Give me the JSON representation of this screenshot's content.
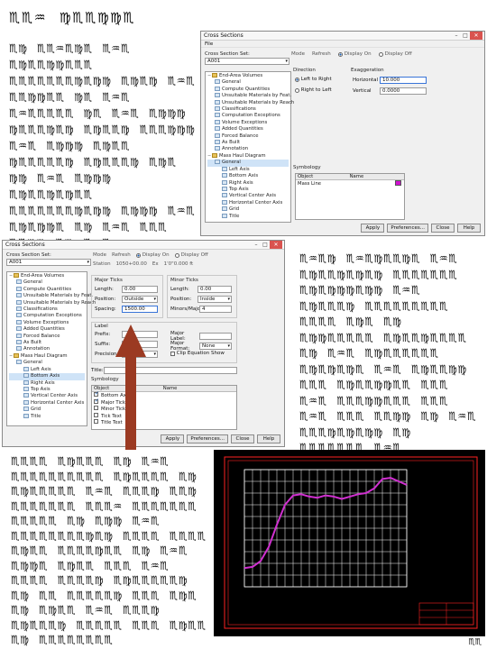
{
  "cipher_text": {
    "title": "♏♏♒ ♍♏♏♍♍♏",
    "p1": "♏♍ ♏♏♒♏♍♏ ♏♒♏ ♏♍♏♏♍♍♏♏♏ ♏♏♏♏♏♏♏♍♏♍♍ ♏♍♏♍ ♏♒♏ ♏♏♍♍♏♏ ♍♏ ♏♒♏ ♏♒♏♏♏♏♏ ♍♏ ♏♒♏ ♏♍♍♍ ♍♏♏♏♍♏♍ ♏♍♏♏♍ ♏♏♏♍♍♍ ♏♒♏ ♏♍♍♍ ♏♍♏♏ ♍♏♏♏♏♏♍ ♏♍♏♏♏♍ ♏♍♏ ♍♍ ♏♒♏ ♏♍♍♍ ♏♍♏♏♍♏♍♏♏ ♏♏♏♏♏♏♏♍♏♍♍ ♏♍♍♍ ♏♒♏ ♏♍♏♍♍♏ ♏♍ ♏♒♏ ♏♏♏ ♏♏♍♍ ♏♍ ♏♒♏ ♏♏♏♍♏♍♏♍♍",
    "p2": "♏♒♏♍ ♏♒♏♍♏♏♍♏ ♏♒♏ ♏♍♏♏♍♏♍♏♍ ♏♏♏♏♏♏♏ ♏♍♏♍♍♍♏♍♍ ♏♒♏ ♏♍♏♏♏♍ ♏♏♏♏♏♏♏♏♏ ♏♏♏♏ ♏♍♏ ♏♍ ♏♍♍♏♏♏♏♏ ♏♍♏♏♍♏♏♏♏ ♏♍ ♏♒♏ ♏♍♏♏♏♏♏♏ ♏♍♏♍♏♍♏ ♏♒♏ ♏♍♏♏♍♍ ♏♏♏ ♏♍♏♏♍♍♏♏ ♏♏♏ ♏♒♏ ♏♏♏♍♍♏♏♏ ♏♏♏ ♏♒♏ ♏♏♏ ♏♏♍♍ ♏♍ ♏♒♏ ♏♏♏♍♏♍♏♍♍ ♏♍ ♏♏♏♏♏♏♏ ♏♒♏",
    "p3": "♏♏♏♏ ♏♍♏♏♏ ♏♍ ♏♒♏ ♏♏♏♏♏♏♏♏♏♏ ♏♍♏♏♏♏ ♏♍ ♏♍♏♏♏♏♏ ♏♒♏ ♏♏♏♍ ♏♏♍ ♏♏♏♏♏♏♏ ♏♏♏♒ ♏♏♏♏♏♏♏ ♏♏♏♏♏ ♏♍ ♏♍♍ ♏♒♏ ♏♏♏♏♏♏♏♏♍♏♍ ♏♏♏♏ ♏♏♏♏ ♏♍♏♏ ♏♏♏♏♍♏♏ ♏♍ ♏♒♏ ♏♍♍♏ ♏♍♏♏ ♏♏♏ ♏♒♏ ♏♏♏♏ ♏♏♏♏♍ ♏♍♏♏♏♏♏♍ ♏♍ ♏♏ ♏♏♏♏♏♍ ♏♏♏ ♏♍♏ ♏♍ ♏♍♏♏ ♏♒♏ ♏♏♏♍ ♏♍♏♏♏♍ ♏♏♏♏♏ ♏♏♏ ♏♍♏♏ ♏♍ ♏♏♏♏♏♏♏♏",
    "page": "♏♏"
  },
  "window_top": {
    "title": "Cross Sections",
    "menu": "File",
    "section_set_label": "Cross Section Set:",
    "section_set_value": "A001",
    "toolbar": {
      "mode": "Mode",
      "refresh": "Refresh",
      "display_on": "Display On",
      "display_off": "Display Off"
    },
    "tree": [
      {
        "label": "End-Area Volumes",
        "level": 0,
        "kind": "folder",
        "expand": "−"
      },
      {
        "label": "General",
        "level": 1,
        "kind": "item"
      },
      {
        "label": "Compute Quantities",
        "level": 1,
        "kind": "item"
      },
      {
        "label": "Unsuitable Materials by Feat.",
        "level": 1,
        "kind": "item"
      },
      {
        "label": "Unsuitable Materials by Reach",
        "level": 1,
        "kind": "item"
      },
      {
        "label": "Classifications",
        "level": 1,
        "kind": "item"
      },
      {
        "label": "Computation Exceptions",
        "level": 1,
        "kind": "item"
      },
      {
        "label": "Volume Exceptions",
        "level": 1,
        "kind": "item"
      },
      {
        "label": "Added Quantities",
        "level": 1,
        "kind": "item"
      },
      {
        "label": "Forced Balance",
        "level": 1,
        "kind": "item"
      },
      {
        "label": "As Built",
        "level": 1,
        "kind": "item"
      },
      {
        "label": "Annotation",
        "level": 1,
        "kind": "item"
      },
      {
        "label": "Mass Haul Diagram",
        "level": 0,
        "kind": "folder",
        "expand": "−"
      },
      {
        "label": "General",
        "level": 1,
        "kind": "item",
        "selected": true
      },
      {
        "label": "Left Axis",
        "level": 2,
        "kind": "item"
      },
      {
        "label": "Bottom Axis",
        "level": 2,
        "kind": "item"
      },
      {
        "label": "Right Axis",
        "level": 2,
        "kind": "item"
      },
      {
        "label": "Top Axis",
        "level": 2,
        "kind": "item"
      },
      {
        "label": "Vertical Center Axis",
        "level": 2,
        "kind": "item"
      },
      {
        "label": "Horizontal Center Axis",
        "level": 2,
        "kind": "item"
      },
      {
        "label": "Grid",
        "level": 2,
        "kind": "item"
      },
      {
        "label": "Title",
        "level": 2,
        "kind": "item"
      }
    ],
    "direction_label": "Direction",
    "dir_left_right": "Left to Right",
    "dir_right_left": "Right to Left",
    "exag_label": "Exaggeration",
    "horizontal_label": "Horizontal",
    "horizontal_value": "10.000",
    "vertical_label": "Vertical",
    "vertical_value": "0.0000",
    "symbology_label": "Symbology",
    "table_headers": [
      "Object",
      "Name"
    ],
    "table_rows": [
      {
        "object": "Mass Line",
        "color": "#d010d0"
      }
    ],
    "buttons": {
      "apply": "Apply",
      "preferences": "Preferences...",
      "close": "Close",
      "help": "Help"
    }
  },
  "window_bot": {
    "title": "Cross Sections",
    "section_set_label": "Cross Section Set:",
    "section_set_value": "A001",
    "toolbar": {
      "mode": "Mode",
      "refresh": "Refresh",
      "display_on": "Display On",
      "display_off": "Display Off",
      "station": "Station",
      "station_value": "1050+00.00",
      "ex": "Ex",
      "ex_value": "1'0\"0.000 ft"
    },
    "tree": [
      {
        "label": "End-Area Volumes",
        "level": 0,
        "kind": "folder",
        "expand": "−"
      },
      {
        "label": "General",
        "level": 1,
        "kind": "item"
      },
      {
        "label": "Compute Quantities",
        "level": 1,
        "kind": "item"
      },
      {
        "label": "Unsuitable Materials by Feat.",
        "level": 1,
        "kind": "item"
      },
      {
        "label": "Unsuitable Materials by Reach",
        "level": 1,
        "kind": "item"
      },
      {
        "label": "Classifications",
        "level": 1,
        "kind": "item"
      },
      {
        "label": "Computation Exceptions",
        "level": 1,
        "kind": "item"
      },
      {
        "label": "Volume Exceptions",
        "level": 1,
        "kind": "item"
      },
      {
        "label": "Added Quantities",
        "level": 1,
        "kind": "item"
      },
      {
        "label": "Forced Balance",
        "level": 1,
        "kind": "item"
      },
      {
        "label": "As Built",
        "level": 1,
        "kind": "item"
      },
      {
        "label": "Annotation",
        "level": 1,
        "kind": "item"
      },
      {
        "label": "Mass Haul Diagram",
        "level": 0,
        "kind": "folder",
        "expand": "−"
      },
      {
        "label": "General",
        "level": 1,
        "kind": "item"
      },
      {
        "label": "Left Axis",
        "level": 2,
        "kind": "item"
      },
      {
        "label": "Bottom Axis",
        "level": 2,
        "kind": "item",
        "selected": true
      },
      {
        "label": "Right Axis",
        "level": 2,
        "kind": "item"
      },
      {
        "label": "Top Axis",
        "level": 2,
        "kind": "item"
      },
      {
        "label": "Vertical Center Axis",
        "level": 2,
        "kind": "item"
      },
      {
        "label": "Horizontal Center Axis",
        "level": 2,
        "kind": "item"
      },
      {
        "label": "Grid",
        "level": 2,
        "kind": "item"
      },
      {
        "label": "Title",
        "level": 2,
        "kind": "item"
      }
    ],
    "major_ticks": "Major Ticks",
    "minor_ticks": "Minor Ticks",
    "length_label": "Length:",
    "major_length": "0.00",
    "minor_length": "0.00",
    "position_label": "Position:",
    "major_position": "Outside",
    "minor_position": "Inside",
    "spacing_label": "Spacing:",
    "major_spacing": "1500.00",
    "minor_per_major_label": "Minors/Major:",
    "minor_per_major": "4",
    "label_group": "Label",
    "prefix_label": "Prefix:",
    "suffix_label": "Suffix:",
    "precision_label": "Precision:",
    "major_label_text": "Major Label:",
    "major_format_label": "Major Format:",
    "major_format_value": "None",
    "clip_label": "Clip Equation Show",
    "title_label": "Title:",
    "symbology_label": "Symbology",
    "table_headers": [
      "Object",
      "Name"
    ],
    "table_rows": [
      {
        "object": "Bottom Axis",
        "checked": true
      },
      {
        "object": "Major Ticks",
        "checked": true
      },
      {
        "object": "Minor Ticks",
        "checked": false
      },
      {
        "object": "Tick Text",
        "checked": false
      },
      {
        "object": "Title Text",
        "checked": false
      }
    ],
    "buttons": {
      "apply": "Apply",
      "preferences": "Preferences...",
      "close": "Close",
      "help": "Help"
    }
  },
  "plot": {
    "background": "#000000",
    "frame_color": "#ff2222",
    "grid_color": "#ffffff",
    "line_color": "#d030d0"
  },
  "chart_data": {
    "type": "line",
    "title": "",
    "xlabel": "",
    "ylabel": "",
    "xlim": [
      0,
      20
    ],
    "ylim": [
      0,
      10
    ],
    "grid": true,
    "x": [
      0,
      1,
      2,
      3,
      4,
      5,
      6,
      7,
      8,
      9,
      10,
      11,
      12,
      13,
      14,
      15,
      16,
      17,
      18,
      19,
      20
    ],
    "series": [
      {
        "values": [
          1.6,
          1.7,
          2.2,
          3.4,
          5.3,
          7.0,
          7.8,
          7.9,
          7.7,
          7.6,
          7.8,
          7.7,
          7.5,
          7.7,
          7.9,
          8.0,
          8.4,
          9.2,
          9.3,
          9.0,
          8.7
        ]
      }
    ]
  }
}
